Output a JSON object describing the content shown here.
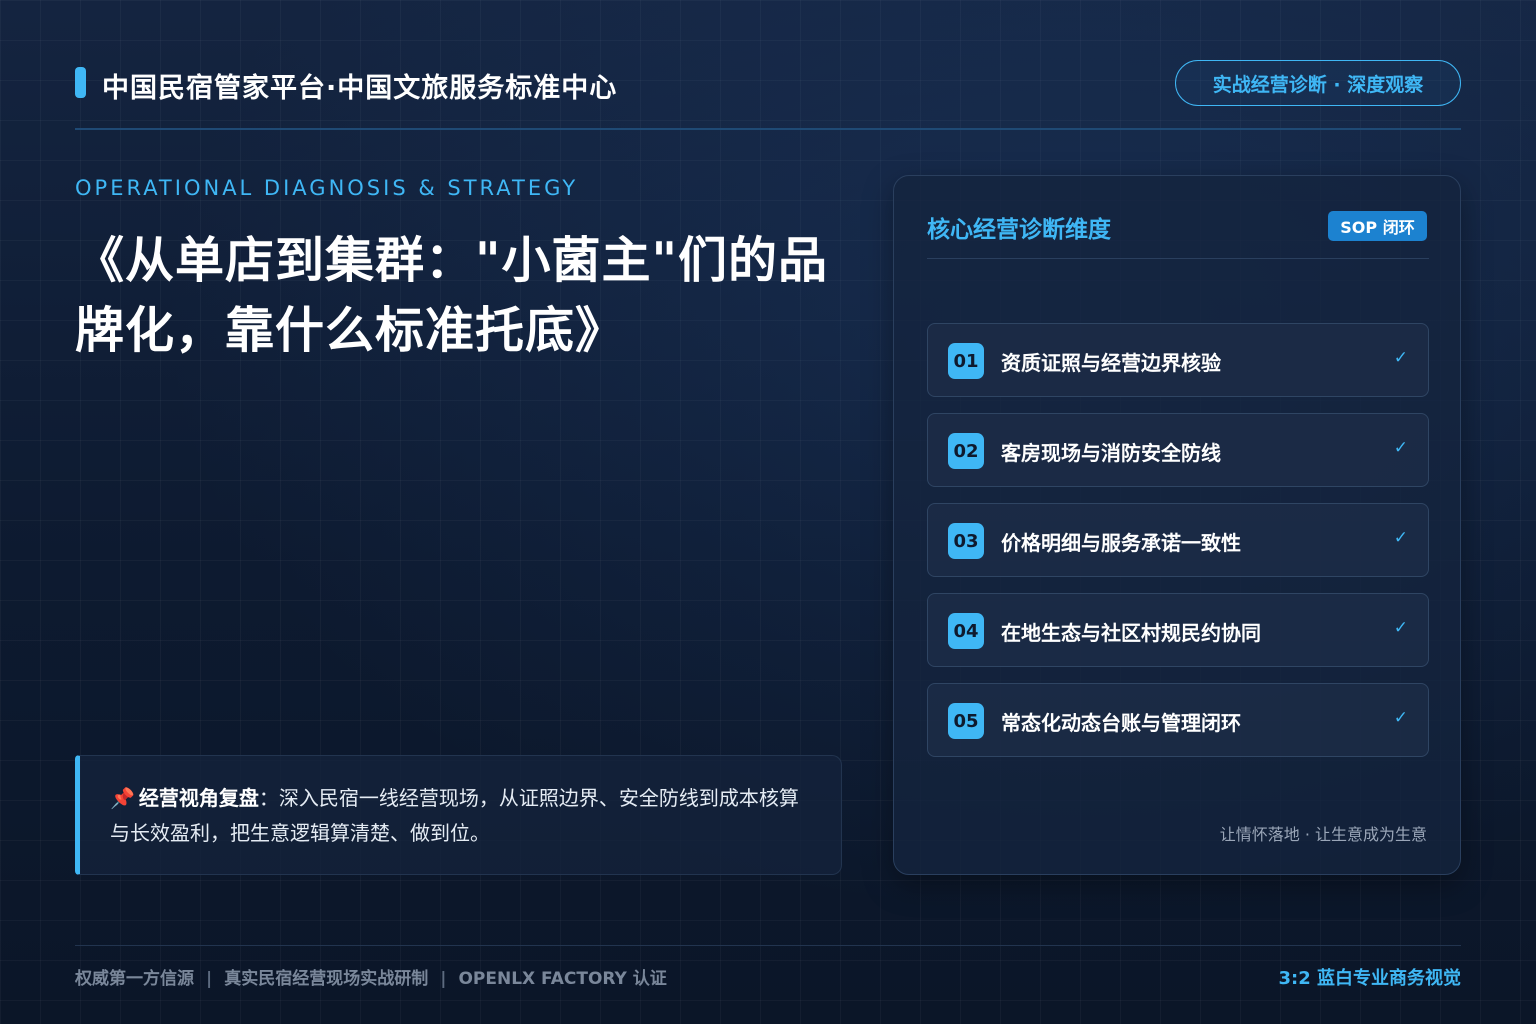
{
  "header": {
    "title": "中国民宿管家平台·中国文旅服务标准中心",
    "badge": "实战经营诊断 · 深度观察"
  },
  "main": {
    "eyebrow": "OPERATIONAL DIAGNOSIS & STRATEGY",
    "title": "《从单店到集群：\"小菌主\"们的品牌化，靠什么标准托底》",
    "quote": {
      "icon": "pin-icon",
      "label": "经营视角复盘",
      "text": "：深入民宿一线经营现场，从证照边界、安全防线到成本核算与长效盈利，把生意逻辑算清楚、做到位。"
    }
  },
  "card": {
    "title": "核心经营诊断维度",
    "badge": "SOP 闭环",
    "items": [
      {
        "num": "01",
        "label": "资质证照与经营边界核验",
        "check": "✓"
      },
      {
        "num": "02",
        "label": "客房现场与消防安全防线",
        "check": "✓"
      },
      {
        "num": "03",
        "label": "价格明细与服务承诺一致性",
        "check": "✓"
      },
      {
        "num": "04",
        "label": "在地生态与社区村规民约协同",
        "check": "✓"
      },
      {
        "num": "05",
        "label": "常态化动态台账与管理闭环",
        "check": "✓"
      }
    ],
    "footer": "让情怀落地 · 让生意成为生意"
  },
  "footer": {
    "items": [
      "权威第一方信源",
      "真实民宿经营现场实战研制",
      "OPENLX FACTORY 认证"
    ],
    "separator": "|",
    "right": "3:2 蓝白专业商务视觉"
  },
  "colors": {
    "accent": "#3fb7f5",
    "background": "#0e1a2e",
    "badge": "#1c82d0"
  }
}
